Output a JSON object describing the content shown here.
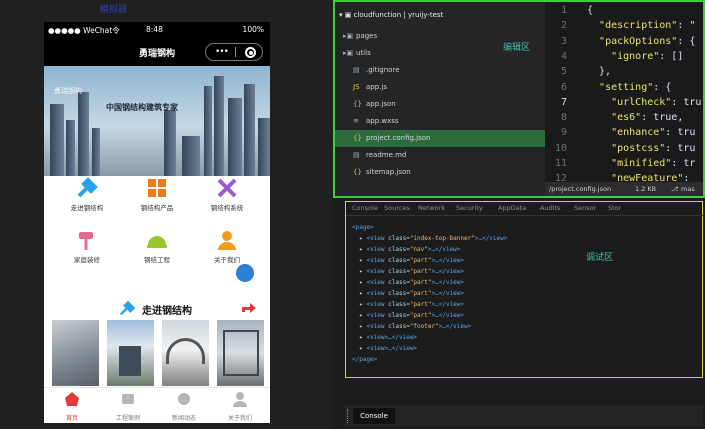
{
  "simulator": {
    "label": "模拟器",
    "status": {
      "carrier": "●●●●● WeChat令",
      "time": "8:48",
      "battery": "100%"
    },
    "nav_title": "勇瑞钢构",
    "banner": {
      "caption": "中国钢结构建筑专家",
      "subtitle": "勇瑞钢构"
    },
    "grid": [
      {
        "label": "走进钢结构",
        "icon": "wrench-icon",
        "color": "#2aa3e8"
      },
      {
        "label": "钢结构产品",
        "icon": "grid-icon",
        "color": "#f07a18"
      },
      {
        "label": "钢结构系统",
        "icon": "tools-icon",
        "color": "#9c5ad0"
      },
      {
        "label": "家庭装修",
        "icon": "paint-roller-icon",
        "color": "#e56a8b"
      },
      {
        "label": "钢结工程",
        "icon": "helmet-icon",
        "color": "#96c72a"
      },
      {
        "label": "关于我们",
        "icon": "person-icon",
        "color": "#f29c1f"
      }
    ],
    "section_title": "走进钢结构",
    "tabs": [
      {
        "label": "首页",
        "icon": "home-icon",
        "active": true
      },
      {
        "label": "工程案例",
        "icon": "case-icon",
        "active": false
      },
      {
        "label": "新闻动态",
        "icon": "news-icon",
        "active": false
      },
      {
        "label": "关于我们",
        "icon": "user-icon",
        "active": false
      }
    ]
  },
  "editor": {
    "label": "编辑区",
    "root": "cloudfunction | yruijy-test",
    "files": [
      {
        "name": "pages",
        "icon": "folder-icon"
      },
      {
        "name": "utils",
        "icon": "folder-icon"
      },
      {
        "name": ".gitignore",
        "icon": "file-icon"
      },
      {
        "name": "app.js",
        "icon": "js-icon"
      },
      {
        "name": "app.json",
        "icon": "json-icon"
      },
      {
        "name": "app.wxss",
        "icon": "wxss-icon"
      },
      {
        "name": "project.config.json",
        "icon": "json-icon",
        "selected": true
      },
      {
        "name": "readme.md",
        "icon": "md-icon"
      },
      {
        "name": "sitemap.json",
        "icon": "json-icon"
      }
    ],
    "line_numbers": [
      "1",
      "2",
      "3",
      "4",
      "5",
      "6",
      "7",
      "8",
      "9",
      "10",
      "11",
      "12"
    ],
    "code_lines": [
      "{",
      "  \"description\": \"",
      "  \"packOptions\": {",
      "    \"ignore\": []",
      "  },",
      "  \"setting\": {",
      "    \"urlCheck\": tru",
      "    \"es6\": true,",
      "    \"enhance\": tru",
      "    \"postcss\": tru",
      "    \"minified\": tr",
      "    \"newFeature\": "
    ],
    "status": {
      "path": "/project.config.json",
      "size": "1.2 KB",
      "branch": "mas"
    }
  },
  "debugger": {
    "label": "调试区",
    "tabs": [
      "Console",
      "Sources",
      "Network",
      "Security",
      "AppData",
      "Audits",
      "Sensor",
      "Stor"
    ],
    "dom": [
      "<page>",
      "  ▸ <view class=\"index-top-banner\">…</view>",
      "  ▸ <view class=\"nav\">…</view>",
      "  ▸ <view class=\"part\">…</view>",
      "  ▸ <view class=\"part\">…</view>",
      "  ▸ <view class=\"part\">…</view>",
      "  ▸ <view class=\"part\">…</view>",
      "  ▸ <view class=\"part\">…</view>",
      "  ▸ <view class=\"part\">…</view>",
      "  ▸ <view class=\"footer\">…</view>",
      "  ▸ <view>…</view>",
      "  ▸ <view>…</view>",
      "</page>"
    ],
    "console_tab": "Console"
  }
}
